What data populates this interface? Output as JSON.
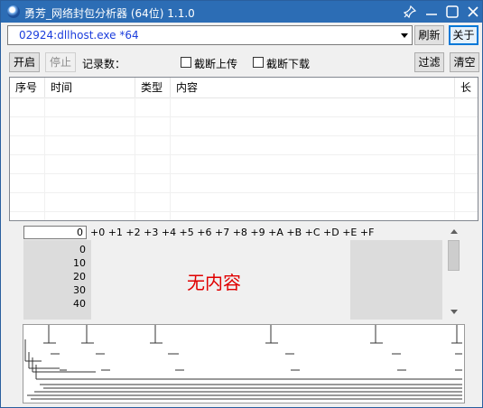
{
  "window": {
    "title": "勇芳_网络封包分析器 (64位) 1.1.0",
    "titlebar_color": "#2c6db5",
    "title_icons": [
      "pin-icon",
      "minimize-icon",
      "maximize-icon",
      "close-icon"
    ]
  },
  "process_select": {
    "value": "02924:dllhost.exe *64",
    "text_color": "#1b3ddc"
  },
  "toolbar": {
    "refresh_label": "刷新",
    "about_label": "关于",
    "start_label": "开启",
    "stop_label": "停止",
    "record_count_label": "记录数：",
    "cut_upload_label": "截断上传",
    "cut_download_label": "截断下载",
    "filter_label": "过滤",
    "clear_label": "清空"
  },
  "packet_list": {
    "columns": [
      "序号",
      "时间",
      "类型",
      "内容",
      "长"
    ],
    "rows": []
  },
  "hex_view": {
    "offset_value": "0",
    "column_header": "+0 +1 +2 +3 +4 +5 +6 +7 +8 +9 +A +B +C +D +E +F",
    "row_offsets": [
      "0",
      "10",
      "20",
      "30",
      "40"
    ],
    "empty_message": "无内容",
    "empty_message_color": "#e00000"
  }
}
